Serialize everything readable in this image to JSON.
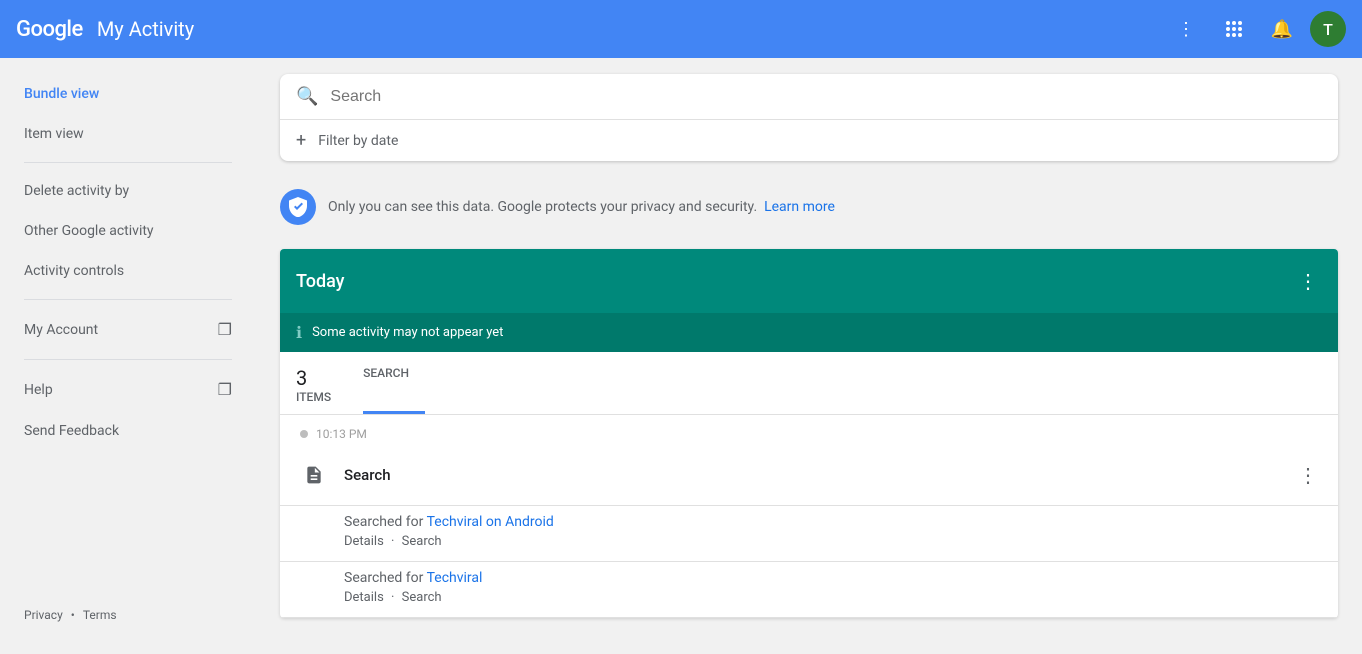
{
  "header": {
    "google_text": "Google",
    "title": "My Activity",
    "avatar_letter": "T",
    "avatar_bg": "#2e7d32"
  },
  "sidebar": {
    "items": [
      {
        "id": "bundle-view",
        "label": "Bundle view",
        "active": true,
        "external": false
      },
      {
        "id": "item-view",
        "label": "Item view",
        "active": false,
        "external": false
      },
      {
        "id": "delete-activity",
        "label": "Delete activity by",
        "active": false,
        "external": false
      },
      {
        "id": "other-google",
        "label": "Other Google activity",
        "active": false,
        "external": false
      },
      {
        "id": "activity-controls",
        "label": "Activity controls",
        "active": false,
        "external": false
      },
      {
        "id": "my-account",
        "label": "My Account",
        "active": false,
        "external": true
      },
      {
        "id": "help",
        "label": "Help",
        "active": false,
        "external": true
      },
      {
        "id": "send-feedback",
        "label": "Send Feedback",
        "active": false,
        "external": false
      }
    ],
    "footer": {
      "privacy": "Privacy",
      "dot": "•",
      "terms": "Terms"
    }
  },
  "search": {
    "placeholder": "Search",
    "filter_label": "Filter by date"
  },
  "privacy_notice": {
    "text": "Only you can see this data. Google protects your privacy and security.",
    "link_text": "Learn more",
    "link_url": "#"
  },
  "today_section": {
    "title": "Today",
    "notice": "Some activity may not appear yet",
    "tabs": [
      {
        "id": "items-tab",
        "label": "ITEMS",
        "count": "3",
        "active": false
      },
      {
        "id": "search-tab",
        "label": "SEARCH",
        "count": "",
        "active": true
      }
    ]
  },
  "activities": [
    {
      "time": "10:13 PM",
      "title": "Search",
      "icon": "📄",
      "searches": [
        {
          "prefix": "Searched for",
          "query": "Techviral on Android",
          "details_label": "Details",
          "search_label": "Search"
        },
        {
          "prefix": "Searched for",
          "query": "Techviral",
          "details_label": "Details",
          "search_label": "Search"
        }
      ]
    }
  ]
}
